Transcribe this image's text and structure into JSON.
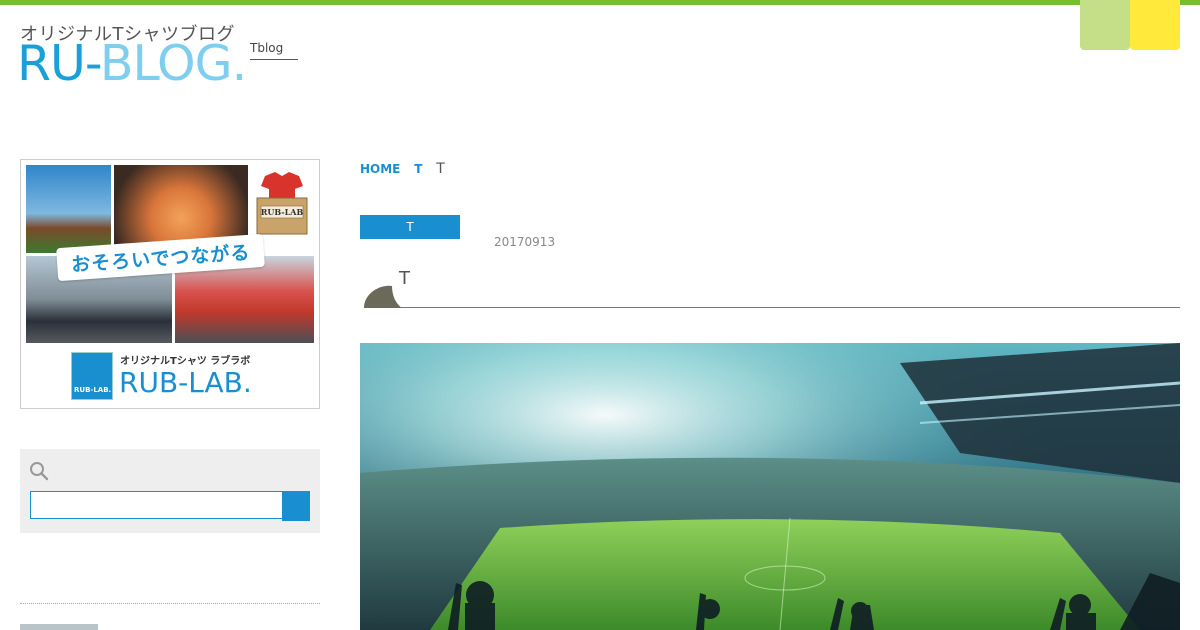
{
  "header": {
    "logo_sub": "オリジナルTシャツブログ",
    "logo_part1": "RU-",
    "logo_part2": "BLOG.",
    "tagline": "Tblog"
  },
  "sidebar": {
    "banner": {
      "catch": "おそろいでつながる",
      "box_label": "RUB-LAB",
      "badge_label": "RUB-LAB.",
      "brand_sub": "オリジナルTシャツ ラブラボ",
      "brand_main": "RUB-LAB."
    },
    "search": {
      "placeholder": "",
      "value": ""
    }
  },
  "breadcrumb": {
    "home": "HOME",
    "category": "T",
    "current": "T"
  },
  "post": {
    "category_tag": "T",
    "date": "20170913",
    "title": "T"
  },
  "colors": {
    "accent_green": "#77be2e",
    "accent_blue": "#1a8fd0",
    "corner_green": "#c4df87",
    "corner_yellow": "#ffe93a",
    "leaf": "#6b6a5a"
  },
  "icons": {
    "search": "search-icon",
    "leaf": "leaf-icon"
  }
}
